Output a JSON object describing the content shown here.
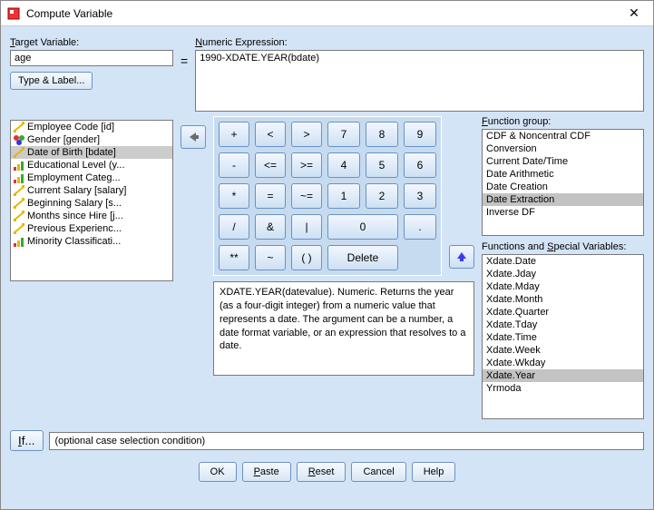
{
  "window": {
    "title": "Compute Variable"
  },
  "labels": {
    "target_variable": "Target Variable:",
    "numeric_expression": "Numeric Expression:",
    "type_and_label": "Type & Label...",
    "function_group": "Function group:",
    "functions_special": "Functions and Special Variables:",
    "if_condition": "(optional case selection condition)",
    "if_button": "If...",
    "equals": "="
  },
  "inputs": {
    "target_variable_value": "age",
    "expression_value": "1990-XDATE.YEAR(bdate)"
  },
  "variables": [
    {
      "label": "Employee Code [id]",
      "icon": "scale",
      "selected": false
    },
    {
      "label": "Gender [gender]",
      "icon": "nominal",
      "selected": false
    },
    {
      "label": "Date of Birth [bdate]",
      "icon": "scale",
      "selected": true
    },
    {
      "label": "Educational Level (y...",
      "icon": "ordinal",
      "selected": false
    },
    {
      "label": "Employment Categ...",
      "icon": "ordinal",
      "selected": false
    },
    {
      "label": "Current Salary [salary]",
      "icon": "scale",
      "selected": false
    },
    {
      "label": "Beginning Salary [s...",
      "icon": "scale",
      "selected": false
    },
    {
      "label": "Months since Hire [j...",
      "icon": "scale",
      "selected": false
    },
    {
      "label": "Previous Experienc...",
      "icon": "scale",
      "selected": false
    },
    {
      "label": "Minority Classificati...",
      "icon": "ordinal",
      "selected": false
    }
  ],
  "keypad": {
    "rows": [
      [
        {
          "t": "+",
          "k": "op"
        },
        {
          "t": "<",
          "k": "op"
        },
        {
          "t": ">",
          "k": "op"
        },
        {
          "t": "7",
          "k": "num"
        },
        {
          "t": "8",
          "k": "num"
        },
        {
          "t": "9",
          "k": "num"
        }
      ],
      [
        {
          "t": "-",
          "k": "op"
        },
        {
          "t": "<=",
          "k": "op"
        },
        {
          "t": ">=",
          "k": "op"
        },
        {
          "t": "4",
          "k": "num"
        },
        {
          "t": "5",
          "k": "num"
        },
        {
          "t": "6",
          "k": "num"
        }
      ],
      [
        {
          "t": "*",
          "k": "op"
        },
        {
          "t": "=",
          "k": "op"
        },
        {
          "t": "~=",
          "k": "op"
        },
        {
          "t": "1",
          "k": "num"
        },
        {
          "t": "2",
          "k": "num"
        },
        {
          "t": "3",
          "k": "num"
        }
      ],
      [
        {
          "t": "/",
          "k": "op"
        },
        {
          "t": "&",
          "k": "op"
        },
        {
          "t": "|",
          "k": "op"
        },
        {
          "t": "0",
          "k": "wide"
        },
        {
          "t": ".",
          "k": "num"
        }
      ],
      [
        {
          "t": "**",
          "k": "op"
        },
        {
          "t": "~",
          "k": "op"
        },
        {
          "t": "( )",
          "k": "op"
        },
        {
          "t": "Delete",
          "k": "del"
        }
      ]
    ]
  },
  "function_groups": [
    {
      "label": "CDF & Noncentral CDF",
      "selected": false
    },
    {
      "label": "Conversion",
      "selected": false
    },
    {
      "label": "Current Date/Time",
      "selected": false
    },
    {
      "label": "Date Arithmetic",
      "selected": false
    },
    {
      "label": "Date Creation",
      "selected": false
    },
    {
      "label": "Date Extraction",
      "selected": true
    },
    {
      "label": "Inverse DF",
      "selected": false
    }
  ],
  "functions": [
    {
      "label": "Xdate.Date",
      "selected": false
    },
    {
      "label": "Xdate.Jday",
      "selected": false
    },
    {
      "label": "Xdate.Mday",
      "selected": false
    },
    {
      "label": "Xdate.Month",
      "selected": false
    },
    {
      "label": "Xdate.Quarter",
      "selected": false
    },
    {
      "label": "Xdate.Tday",
      "selected": false
    },
    {
      "label": "Xdate.Time",
      "selected": false
    },
    {
      "label": "Xdate.Week",
      "selected": false
    },
    {
      "label": "Xdate.Wkday",
      "selected": false
    },
    {
      "label": "Xdate.Year",
      "selected": true
    },
    {
      "label": "Yrmoda",
      "selected": false
    }
  ],
  "description": "XDATE.YEAR(datevalue). Numeric. Returns the year (as a four-digit integer) from a numeric value that represents a date. The argument can be a number, a date format variable, or an expression that resolves to a date.",
  "buttons": {
    "ok": "OK",
    "paste": "Paste",
    "reset": "Reset",
    "cancel": "Cancel",
    "help": "Help"
  }
}
